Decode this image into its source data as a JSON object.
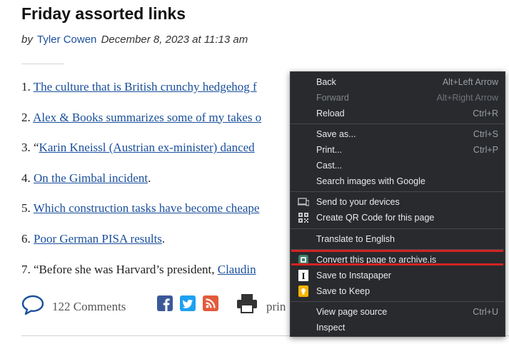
{
  "article": {
    "title": "Friday assorted links",
    "byline_prefix": "by",
    "author": "Tyler Cowen",
    "date": "December 8, 2023 at 11:13 am",
    "items": [
      {
        "num": "1.",
        "pre": "",
        "link": "The culture that is British crunchy hedgehog f",
        "post": ""
      },
      {
        "num": "2.",
        "pre": "",
        "link": "Alex & Books summarizes some of my takes o",
        "post": ""
      },
      {
        "num": "3.",
        "pre": "“",
        "link": "Karin Kneissl (Austrian ex-minister) danced",
        "post": ""
      },
      {
        "num": "4.",
        "pre": "",
        "link": "On the Gimbal incident",
        "post": "."
      },
      {
        "num": "5.",
        "pre": "",
        "link": "Which construction tasks have become cheape",
        "post": ""
      },
      {
        "num": "6.",
        "pre": "",
        "link": "Poor German PISA results",
        "post": "."
      },
      {
        "num": "7.",
        "pre": "“Before she was Harvard’s president, ",
        "link": "Claudin",
        "post": ""
      }
    ],
    "comments_label": "122 Comments",
    "print_label": "prin",
    "colors": {
      "link": "#1a4f9c",
      "facebook": "#3b5998",
      "twitter": "#1da1f2",
      "rss": "#e25a3b"
    }
  },
  "context_menu": {
    "items": [
      {
        "label": "Back",
        "shortcut": "Alt+Left Arrow",
        "disabled": false
      },
      {
        "label": "Forward",
        "shortcut": "Alt+Right Arrow",
        "disabled": true
      },
      {
        "label": "Reload",
        "shortcut": "Ctrl+R",
        "disabled": false
      },
      {
        "label": "Save as...",
        "shortcut": "Ctrl+S",
        "disabled": false
      },
      {
        "label": "Print...",
        "shortcut": "Ctrl+P",
        "disabled": false
      },
      {
        "label": "Cast...",
        "shortcut": "",
        "disabled": false
      },
      {
        "label": "Search images with Google",
        "shortcut": "",
        "disabled": false
      },
      {
        "label": "Send to your devices",
        "shortcut": "",
        "icon": "devices-icon",
        "disabled": false
      },
      {
        "label": "Create QR Code for this page",
        "shortcut": "",
        "icon": "qr-code-icon",
        "disabled": false
      },
      {
        "label": "Translate to English",
        "shortcut": "",
        "disabled": false
      },
      {
        "label": "Convert this page to archive.is",
        "shortcut": "",
        "icon": "archive-is-icon",
        "disabled": false
      },
      {
        "label": "Save to Instapaper",
        "shortcut": "",
        "icon": "instapaper-icon",
        "disabled": false
      },
      {
        "label": "Save to Keep",
        "shortcut": "",
        "icon": "keep-icon",
        "disabled": false
      },
      {
        "label": "View page source",
        "shortcut": "Ctrl+U",
        "disabled": false
      },
      {
        "label": "Inspect",
        "shortcut": "",
        "disabled": false
      }
    ],
    "highlight_color": "#d32323",
    "background": "#292a2d"
  }
}
